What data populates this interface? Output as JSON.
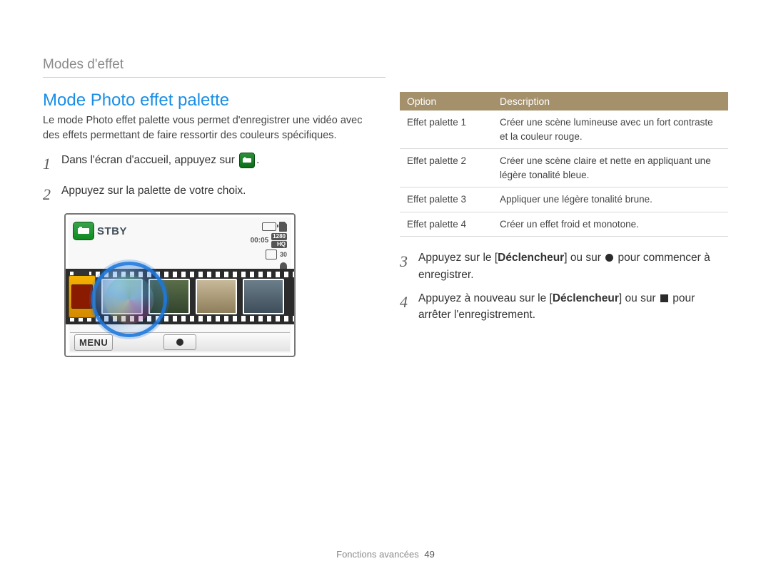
{
  "section": "Modes d'effet",
  "heading": "Mode Photo effet palette",
  "intro": "Le mode Photo effet palette vous permet d'enregistrer une vidéo avec des effets permettant de faire ressortir des couleurs spécifiques.",
  "steps": {
    "s1": {
      "num": "1",
      "pre": "Dans l'écran d'accueil, appuyez sur ",
      "post": "."
    },
    "s2": {
      "num": "2",
      "text": "Appuyez sur la palette de votre choix."
    },
    "s3": {
      "num": "3",
      "pre": "Appuyez sur le [",
      "bold": "Déclencheur",
      "mid": "] ou sur ",
      "post": " pour commencer à enregistrer."
    },
    "s4": {
      "num": "4",
      "pre": "Appuyez à nouveau sur le [",
      "bold": "Déclencheur",
      "mid": "] ou sur ",
      "post": " pour arrêter l'enregistrement."
    }
  },
  "screen": {
    "stby": "STBY",
    "time": "00:05",
    "res_top": "1280",
    "res_sub": "HQ",
    "fps": "30",
    "menu": "MENU"
  },
  "table": {
    "headers": {
      "option": "Option",
      "description": "Description"
    },
    "rows": [
      {
        "opt": "Effet palette 1",
        "desc": "Créer une scène lumineuse avec un fort contraste et la couleur rouge."
      },
      {
        "opt": "Effet palette 2",
        "desc": "Créer une scène claire et nette en appliquant une légère tonalité bleue."
      },
      {
        "opt": "Effet palette 3",
        "desc": "Appliquer une légère tonalité brune."
      },
      {
        "opt": "Effet palette 4",
        "desc": "Créer un effet froid et monotone."
      }
    ]
  },
  "footer": {
    "label": "Fonctions avancées",
    "page": "49"
  }
}
